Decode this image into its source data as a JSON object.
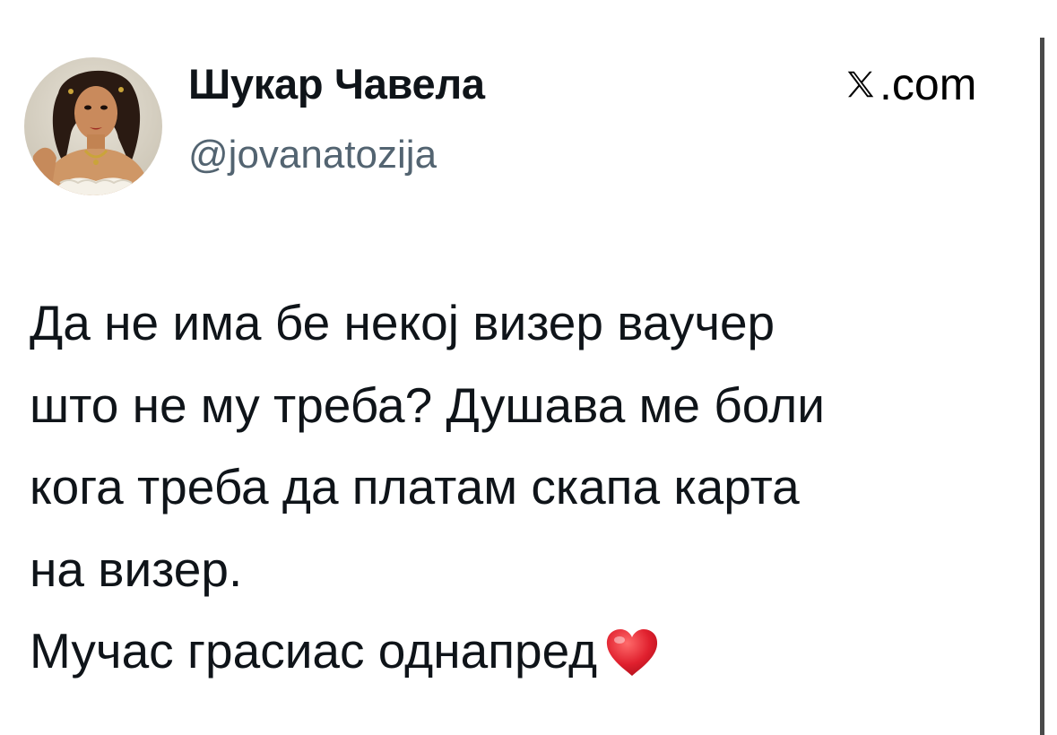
{
  "tweet": {
    "author_name": "Шукар Чавела",
    "author_handle": "@jovanatozija",
    "source_label": ".com",
    "source_icon": "x-logo-icon",
    "text_lines": [
      "Да не има бе некој визер ваучер",
      "што не му треба? Душава ме боли",
      "кога треба да платам скапа карта",
      "на визер.",
      "Мучас грасиас однапред"
    ],
    "trailing_emoji": "heart-icon"
  },
  "colors": {
    "text": "#0f1419",
    "handle": "#536471",
    "heart": "#e0202e",
    "scrollbar": "#4a4a4a"
  }
}
